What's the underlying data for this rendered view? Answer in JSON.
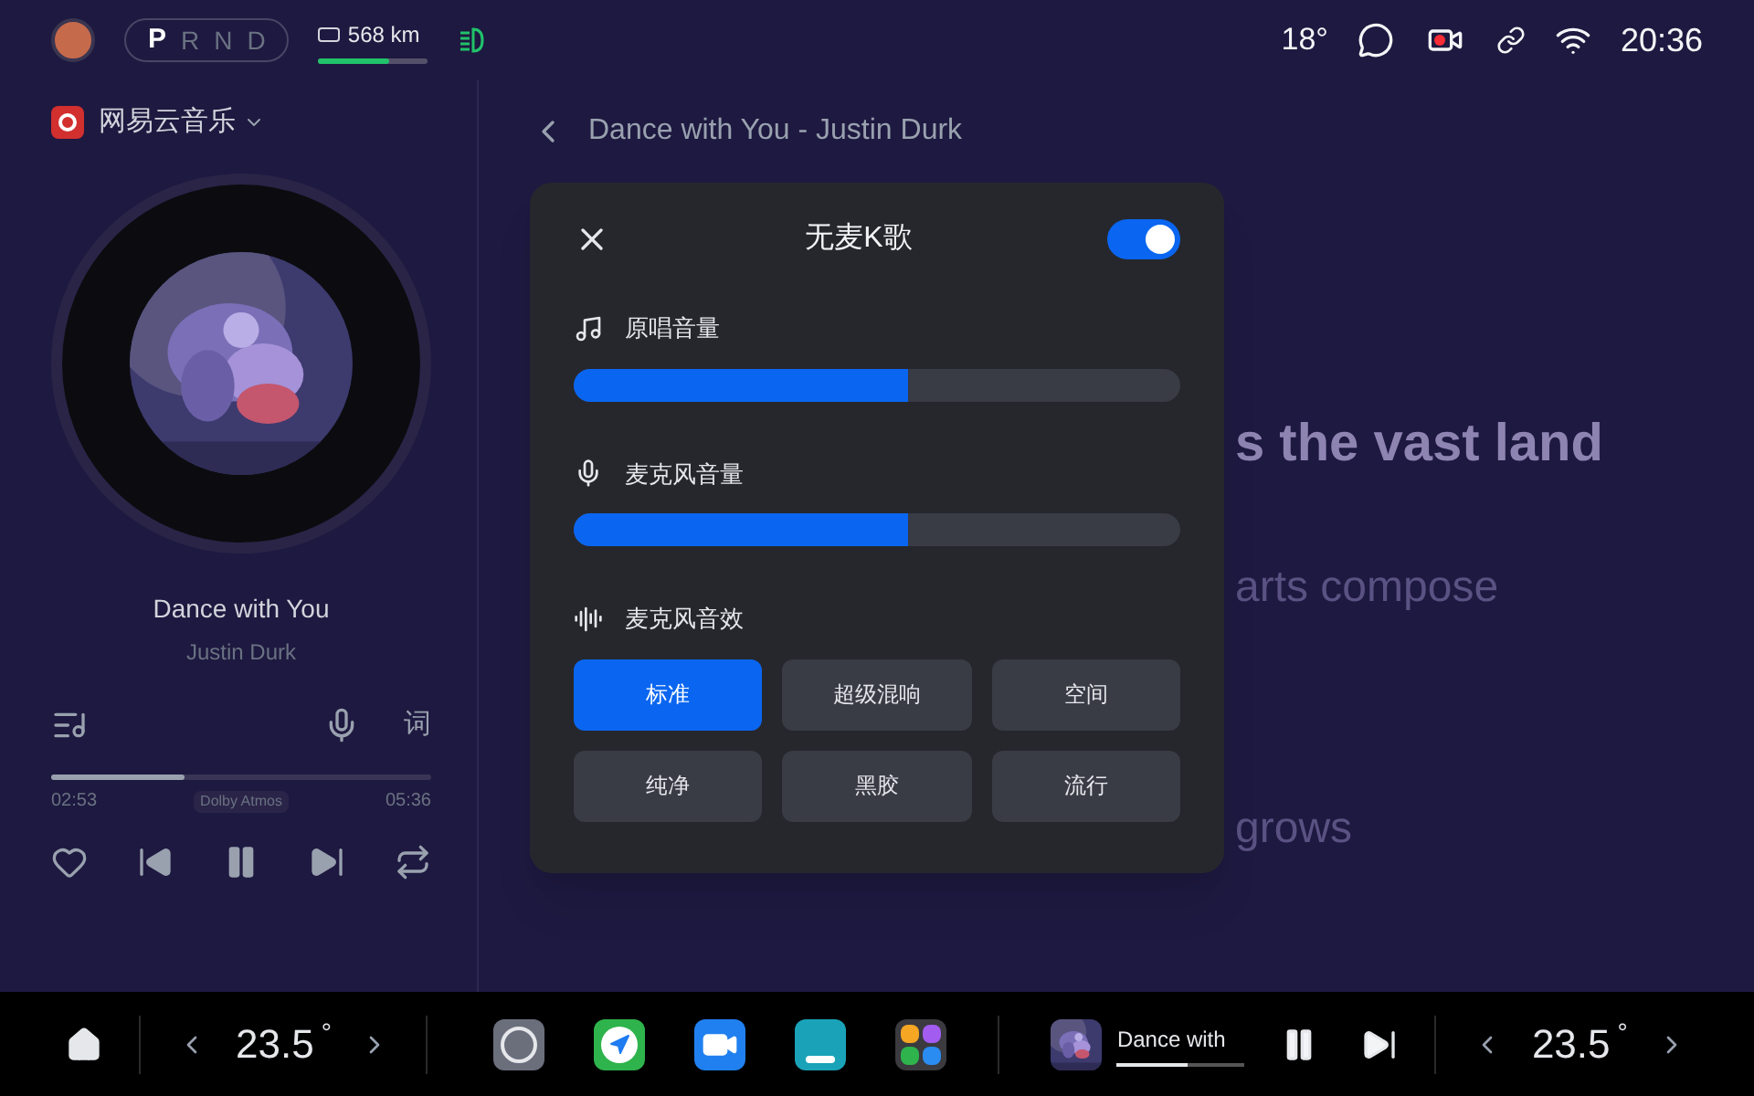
{
  "status_bar": {
    "gears": [
      {
        "label": "P",
        "selected": true
      },
      {
        "label": "R",
        "selected": false
      },
      {
        "label": "N",
        "selected": false
      },
      {
        "label": "D",
        "selected": false
      }
    ],
    "range": {
      "text": "568 km",
      "level": 0.65
    },
    "temperature": "18°",
    "time": "20:36"
  },
  "player": {
    "app_name": "网易云音乐",
    "title": "Dance with You",
    "artist": "Justin Durk",
    "lyrics_button": "词",
    "progress": {
      "level": 0.35,
      "elapsed": "02:53",
      "total": "05:36",
      "badge": "Dolby Atmos"
    }
  },
  "lyrics": {
    "header": "Dance with You - Justin Durk",
    "lines": [
      {
        "text": "s the vast land",
        "selected": true
      },
      {
        "text": "arts compose",
        "selected": false
      },
      {
        "text": "grows",
        "selected": false
      }
    ]
  },
  "dialog": {
    "title": "无麦K歌",
    "on": true,
    "sliders": [
      {
        "kind": "music",
        "label": "原唱音量",
        "level": 0.55
      },
      {
        "kind": "mic",
        "label": "麦克风音量",
        "level": 0.55
      }
    ],
    "effects_label": "麦克风音效",
    "effects": [
      {
        "label": "标准",
        "selected": true
      },
      {
        "label": "超级混响",
        "selected": false
      },
      {
        "label": "空间",
        "selected": false
      },
      {
        "label": "纯净",
        "selected": false
      },
      {
        "label": "黑胶",
        "selected": false
      },
      {
        "label": "流行",
        "selected": false
      }
    ]
  },
  "dock": {
    "climate_left": {
      "value": "23.5",
      "unit": "°"
    },
    "apps": [
      {
        "kind": "settings"
      },
      {
        "kind": "maps"
      },
      {
        "kind": "video"
      },
      {
        "kind": "seat"
      },
      {
        "kind": "grid"
      }
    ],
    "now_playing": {
      "title": "Dance with",
      "level": 0.55
    },
    "climate_right": {
      "value": "23.5",
      "unit": "°"
    }
  }
}
